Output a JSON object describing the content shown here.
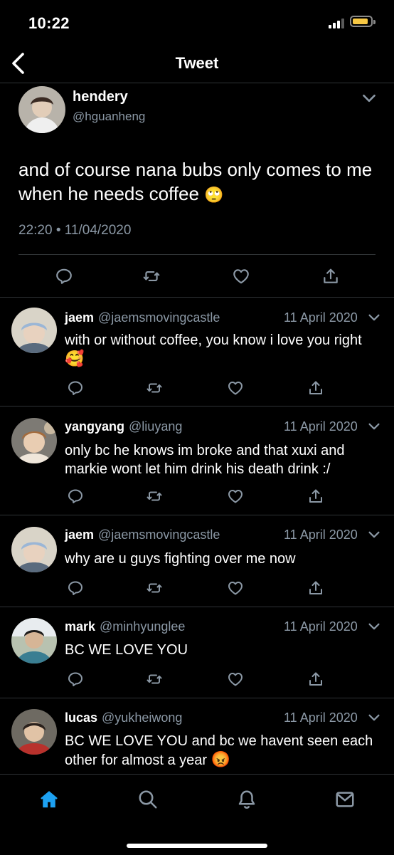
{
  "status_bar": {
    "time": "10:22"
  },
  "nav": {
    "title": "Tweet"
  },
  "main_tweet": {
    "name": "hendery",
    "handle": "@hguanheng",
    "text": "and of course nana bubs only comes to me when he needs coffee",
    "emoji": "🙄",
    "timestamp": "22:20 • 11/04/2020"
  },
  "replies": [
    {
      "name": "jaem",
      "handle": "@jaemsmovingcastle",
      "date": "11 April 2020",
      "text": "with or without coffee, you know i love you right",
      "emoji": "🥰"
    },
    {
      "name": "yangyang",
      "handle": "@liuyang",
      "date": "11 April 2020",
      "text": "only bc he knows im broke and that xuxi and markie wont let him drink his death drink :/",
      "emoji": ""
    },
    {
      "name": "jaem",
      "handle": "@jaemsmovingcastle",
      "date": "11 April 2020",
      "text": "why are u guys fighting over me now",
      "emoji": ""
    },
    {
      "name": "mark",
      "handle": "@minhyunglee",
      "date": "11 April 2020",
      "text": "BC WE LOVE YOU",
      "emoji": ""
    },
    {
      "name": "lucas",
      "handle": "@yukheiwong",
      "date": "11 April 2020",
      "text": "BC WE LOVE YOU and bc we havent seen each other for almost a year",
      "emoji": "😡"
    }
  ],
  "tabs": [
    {
      "icon": "home-icon",
      "active": true
    },
    {
      "icon": "search-icon",
      "active": false
    },
    {
      "icon": "bell-icon",
      "active": false
    },
    {
      "icon": "mail-icon",
      "active": false
    }
  ],
  "colors": {
    "accent": "#1da1f2",
    "muted": "#8b98a5",
    "divider": "#2f3336",
    "battery": "#f7c844"
  }
}
